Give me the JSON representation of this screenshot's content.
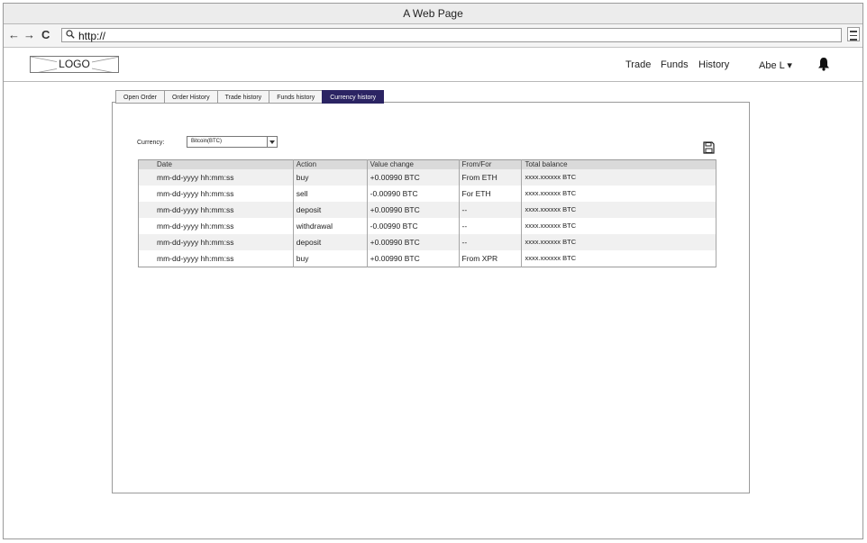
{
  "browser": {
    "title": "A Web Page",
    "url": "http://",
    "back": "←",
    "forward": "→",
    "reload": "C"
  },
  "header": {
    "logo": "LOGO",
    "nav": [
      "Trade",
      "Funds",
      "History"
    ],
    "user": "Abe L ▾"
  },
  "tabs": [
    "Open Order",
    "Order History",
    "Trade history",
    "Funds history",
    "Currency history"
  ],
  "active_tab": "Currency history",
  "filter": {
    "label": "Currency:",
    "selected": "Bitcoin(BTC)"
  },
  "table": {
    "columns": [
      "Date",
      "Action",
      "Value change",
      "From/For",
      "Total balance"
    ],
    "rows": [
      [
        "mm-dd-yyyy hh:mm:ss",
        "buy",
        "+0.00990 BTC",
        "From ETH",
        "xxxx.xxxxxx BTC"
      ],
      [
        "mm-dd-yyyy hh:mm:ss",
        "sell",
        "-0.00990 BTC",
        "For ETH",
        "xxxx.xxxxxx BTC"
      ],
      [
        "mm-dd-yyyy hh:mm:ss",
        "deposit",
        "+0.00990 BTC",
        "--",
        "xxxx.xxxxxx BTC"
      ],
      [
        "mm-dd-yyyy hh:mm:ss",
        "withdrawal",
        "-0.00990 BTC",
        "--",
        "xxxx.xxxxxx BTC"
      ],
      [
        "mm-dd-yyyy hh:mm:ss",
        "deposit",
        "+0.00990 BTC",
        "--",
        "xxxx.xxxxxx BTC"
      ],
      [
        "mm-dd-yyyy hh:mm:ss",
        "buy",
        "+0.00990 BTC",
        "From XPR",
        "xxxx.xxxxxx BTC"
      ]
    ]
  },
  "colors": {
    "active_tab": "#2b2463",
    "header_row": "#dadada",
    "odd_row": "#f0f0f0"
  },
  "icons": [
    "search-icon",
    "menu-icon",
    "bell-icon",
    "save-icon",
    "chevron-down-icon"
  ]
}
